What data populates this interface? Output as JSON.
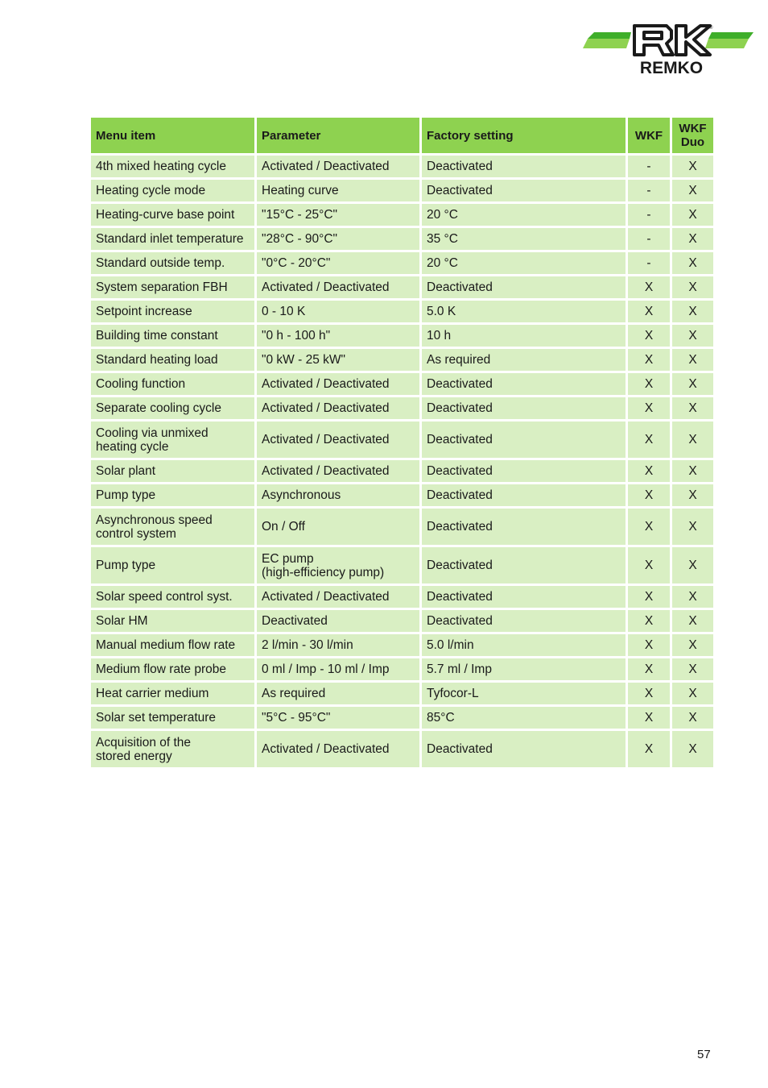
{
  "brand": {
    "name": "REMKO",
    "logo_icon": "remko-logo-icon",
    "colors": {
      "stripe_dark": "#3fae2a",
      "stripe_light": "#8ed250",
      "header_bg": "#8ed250",
      "row_bg": "#d9efc3"
    }
  },
  "table": {
    "headers": [
      "Menu item",
      "Parameter",
      "Factory setting",
      "WKF",
      "WKF\nDuo"
    ],
    "rows": [
      {
        "menu_item": "4th mixed heating cycle",
        "parameter": "Activated / Deactivated",
        "factory_setting": "Deactivated",
        "wkf": "-",
        "wkf_duo": "X"
      },
      {
        "menu_item": "Heating cycle mode",
        "parameter": "Heating curve",
        "factory_setting": "Deactivated",
        "wkf": "-",
        "wkf_duo": "X"
      },
      {
        "menu_item": "Heating-curve base point",
        "parameter": "\"15°C - 25°C\"",
        "factory_setting": "20 °C",
        "wkf": "-",
        "wkf_duo": "X"
      },
      {
        "menu_item": "Standard inlet temperature",
        "parameter": "\"28°C - 90°C\"",
        "factory_setting": "35 °C",
        "wkf": "-",
        "wkf_duo": "X"
      },
      {
        "menu_item": "Standard outside temp.",
        "parameter": "\"0°C - 20°C\"",
        "factory_setting": "20 °C",
        "wkf": "-",
        "wkf_duo": "X"
      },
      {
        "menu_item": "System separation FBH",
        "parameter": "Activated / Deactivated",
        "factory_setting": "Deactivated",
        "wkf": "X",
        "wkf_duo": "X"
      },
      {
        "menu_item": "Setpoint increase",
        "parameter": "0 - 10 K",
        "factory_setting": "5.0 K",
        "wkf": "X",
        "wkf_duo": "X"
      },
      {
        "menu_item": "Building time constant",
        "parameter": "\"0 h - 100 h\"",
        "factory_setting": "10 h",
        "wkf": "X",
        "wkf_duo": "X"
      },
      {
        "menu_item": "Standard heating load",
        "parameter": "\"0 kW - 25 kW\"",
        "factory_setting": "As required",
        "wkf": "X",
        "wkf_duo": "X"
      },
      {
        "menu_item": "Cooling function",
        "parameter": "Activated / Deactivated",
        "factory_setting": "Deactivated",
        "wkf": "X",
        "wkf_duo": "X"
      },
      {
        "menu_item": "Separate cooling cycle",
        "parameter": "Activated / Deactivated",
        "factory_setting": "Deactivated",
        "wkf": "X",
        "wkf_duo": "X"
      },
      {
        "menu_item": "Cooling via unmixed\nheating cycle",
        "parameter": "Activated / Deactivated",
        "factory_setting": "Deactivated",
        "wkf": "X",
        "wkf_duo": "X"
      },
      {
        "menu_item": "Solar plant",
        "parameter": "Activated / Deactivated",
        "factory_setting": "Deactivated",
        "wkf": "X",
        "wkf_duo": "X"
      },
      {
        "menu_item": "Pump type",
        "parameter": "Asynchronous",
        "factory_setting": "Deactivated",
        "wkf": "X",
        "wkf_duo": "X"
      },
      {
        "menu_item": "Asynchronous speed\ncontrol system",
        "parameter": "On / Off",
        "factory_setting": "Deactivated",
        "wkf": "X",
        "wkf_duo": "X"
      },
      {
        "menu_item": "Pump type",
        "parameter": "EC pump\n(high-efficiency pump)",
        "factory_setting": "Deactivated",
        "wkf": "X",
        "wkf_duo": "X"
      },
      {
        "menu_item": "Solar speed control syst.",
        "parameter": "Activated / Deactivated",
        "factory_setting": "Deactivated",
        "wkf": "X",
        "wkf_duo": "X"
      },
      {
        "menu_item": "Solar HM",
        "parameter": "Deactivated",
        "factory_setting": "Deactivated",
        "wkf": "X",
        "wkf_duo": "X"
      },
      {
        "menu_item": "Manual medium flow rate",
        "parameter": "2 l/min - 30 l/min",
        "factory_setting": "5.0 l/min",
        "wkf": "X",
        "wkf_duo": "X"
      },
      {
        "menu_item": "Medium flow rate probe",
        "parameter": "0 ml / Imp - 10 ml / Imp",
        "factory_setting": "5.7 ml / Imp",
        "wkf": "X",
        "wkf_duo": "X"
      },
      {
        "menu_item": "Heat carrier medium",
        "parameter": "As required",
        "factory_setting": "Tyfocor-L",
        "wkf": "X",
        "wkf_duo": "X"
      },
      {
        "menu_item": "Solar set temperature",
        "parameter": "\"5°C - 95°C\"",
        "factory_setting": "85°C",
        "wkf": "X",
        "wkf_duo": "X"
      },
      {
        "menu_item": "Acquisition of the\nstored energy",
        "parameter": "Activated / Deactivated",
        "factory_setting": "Deactivated",
        "wkf": "X",
        "wkf_duo": "X"
      }
    ]
  },
  "footer": {
    "page_number": "57"
  }
}
